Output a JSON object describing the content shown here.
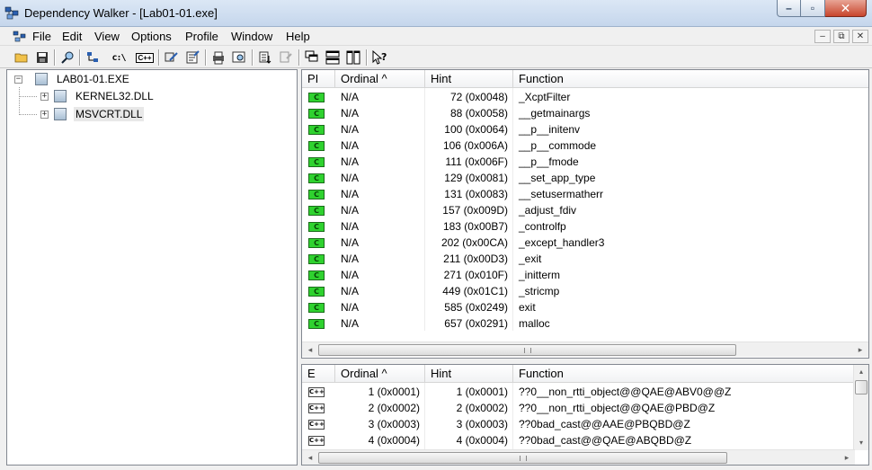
{
  "window": {
    "title": "Dependency Walker - [Lab01-01.exe]"
  },
  "menubar": {
    "items": [
      "File",
      "Edit",
      "View",
      "Options",
      "Profile",
      "Window",
      "Help"
    ]
  },
  "tree": {
    "root": "LAB01-01.EXE",
    "children": [
      {
        "label": "KERNEL32.DLL",
        "expander": "+"
      },
      {
        "label": "MSVCRT.DLL",
        "expander": "+",
        "selected": true
      }
    ],
    "root_expander": "−"
  },
  "imports": {
    "headers": [
      "PI",
      "Ordinal ^",
      "Hint",
      "Function"
    ],
    "badge": "C",
    "rows": [
      {
        "ordinal": "N/A",
        "hint": "72 (0x0048)",
        "function": "_XcptFilter"
      },
      {
        "ordinal": "N/A",
        "hint": "88 (0x0058)",
        "function": "__getmainargs"
      },
      {
        "ordinal": "N/A",
        "hint": "100 (0x0064)",
        "function": "__p__initenv"
      },
      {
        "ordinal": "N/A",
        "hint": "106 (0x006A)",
        "function": "__p__commode"
      },
      {
        "ordinal": "N/A",
        "hint": "111 (0x006F)",
        "function": "__p__fmode"
      },
      {
        "ordinal": "N/A",
        "hint": "129 (0x0081)",
        "function": "__set_app_type"
      },
      {
        "ordinal": "N/A",
        "hint": "131 (0x0083)",
        "function": "__setusermatherr"
      },
      {
        "ordinal": "N/A",
        "hint": "157 (0x009D)",
        "function": "_adjust_fdiv"
      },
      {
        "ordinal": "N/A",
        "hint": "183 (0x00B7)",
        "function": "_controlfp"
      },
      {
        "ordinal": "N/A",
        "hint": "202 (0x00CA)",
        "function": "_except_handler3"
      },
      {
        "ordinal": "N/A",
        "hint": "211 (0x00D3)",
        "function": "_exit"
      },
      {
        "ordinal": "N/A",
        "hint": "271 (0x010F)",
        "function": "_initterm"
      },
      {
        "ordinal": "N/A",
        "hint": "449 (0x01C1)",
        "function": "_stricmp"
      },
      {
        "ordinal": "N/A",
        "hint": "585 (0x0249)",
        "function": "exit"
      },
      {
        "ordinal": "N/A",
        "hint": "657 (0x0291)",
        "function": "malloc"
      }
    ]
  },
  "exports": {
    "headers": [
      "E",
      "Ordinal ^",
      "Hint",
      "Function"
    ],
    "badge": "C++",
    "rows": [
      {
        "ordinal": "1 (0x0001)",
        "hint": "1 (0x0001)",
        "function": "??0__non_rtti_object@@QAE@ABV0@@Z"
      },
      {
        "ordinal": "2 (0x0002)",
        "hint": "2 (0x0002)",
        "function": "??0__non_rtti_object@@QAE@PBD@Z"
      },
      {
        "ordinal": "3 (0x0003)",
        "hint": "3 (0x0003)",
        "function": "??0bad_cast@@AAE@PBQBD@Z"
      },
      {
        "ordinal": "4 (0x0004)",
        "hint": "4 (0x0004)",
        "function": "??0bad_cast@@QAE@ABQBD@Z"
      }
    ]
  },
  "colors": {
    "import_badge": "#2fd22f",
    "close_button": "#c8452c"
  }
}
